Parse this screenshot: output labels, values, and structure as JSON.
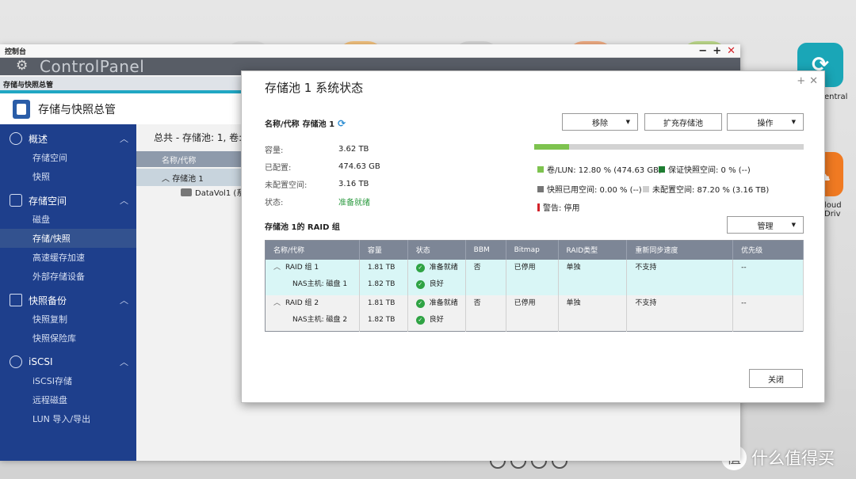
{
  "desktop": {
    "right_label_1": "entral",
    "right_label_2": "loud Driv",
    "watermark_logo": "值",
    "watermark_text": "什么值得买"
  },
  "control_panel": {
    "window_title": "控制台",
    "banner_title": "ControlPanel",
    "breadcrumb": "存储与快照总管",
    "header_title": "存储与快照总管",
    "summary": "总共 - 存储池: 1, 卷: 1, ",
    "table_header": "名称/代称",
    "pool_row": "存储池 1",
    "volume_row": "DataVol1 (系",
    "sidebar": [
      {
        "label": "概述",
        "items": [
          "存储空间",
          "快照"
        ]
      },
      {
        "label": "存储空间",
        "items": [
          "磁盘",
          "存储/快照",
          "高速缓存加速",
          "外部存储设备"
        ]
      },
      {
        "label": "快照备份",
        "items": [
          "快照复制",
          "快照保险库"
        ]
      },
      {
        "label": "iSCSI",
        "items": [
          "iSCSI存储",
          "远程磁盘",
          "LUN 导入/导出"
        ]
      }
    ]
  },
  "modal": {
    "title": "存储池 1 系统状态",
    "name_label": "名称/代称",
    "name_value": "存储池 1",
    "info": [
      {
        "key": "容量:",
        "value": "3.62 TB"
      },
      {
        "key": "已配置:",
        "value": "474.63 GB"
      },
      {
        "key": "未配置空间:",
        "value": "3.16 TB"
      },
      {
        "key": "状态:",
        "value": "准备就绪"
      }
    ],
    "buttons": {
      "remove": "移除",
      "expand": "扩充存储池",
      "action": "操作",
      "manage": "管理",
      "close": "关闭"
    },
    "usage_percent": 12.8,
    "legend": [
      {
        "label": "卷/LUN: 12.80 % (474.63 GB)",
        "color": "#7ec34f"
      },
      {
        "label": "保证快照空间: 0 % (--)",
        "color": "#1e7d32"
      },
      {
        "label": "快照已用空间: 0.00 % (--)",
        "color": "#767676"
      },
      {
        "label": "未配置空间: 87.20 % (3.16 TB)",
        "color": "#cfcfcf"
      },
      {
        "label": "警告: 停用",
        "color": "#d3232a"
      }
    ],
    "raid_title": "存储池 1的 RAID 组",
    "raid_columns": [
      "名称/代称",
      "容量",
      "状态",
      "BBM",
      "Bitmap",
      "RAID类型",
      "重新同步速度",
      "优先级"
    ],
    "raid_groups": [
      {
        "name": "RAID 组 1",
        "disk": "NAS主机: 磁盘 1",
        "capacity": "1.81 TB",
        "disk_capacity": "1.82 TB",
        "status": "准备就绪",
        "disk_status": "良好",
        "bbm": "否",
        "bitmap": "已停用",
        "raid_type": "单独",
        "resync": "不支持",
        "priority": "--"
      },
      {
        "name": "RAID 组 2",
        "disk": "NAS主机: 磁盘 2",
        "capacity": "1.81 TB",
        "disk_capacity": "1.82 TB",
        "status": "准备就绪",
        "disk_status": "良好",
        "bbm": "否",
        "bitmap": "已停用",
        "raid_type": "单独",
        "resync": "不支持",
        "priority": "--"
      }
    ]
  }
}
